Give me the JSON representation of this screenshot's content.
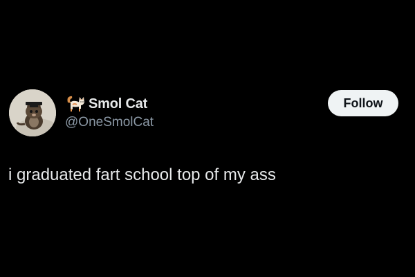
{
  "tweet": {
    "display_name": "Smol Cat",
    "name_emoji": "cat-emoji",
    "handle": "@OneSmolCat",
    "text": "i graduated fart school top of my ass",
    "follow_label": "Follow"
  },
  "colors": {
    "background": "#000000",
    "primary_text": "#e7e9ea",
    "secondary_text": "#8b98a5",
    "follow_bg": "#eff3f4",
    "follow_text": "#0f1419"
  }
}
